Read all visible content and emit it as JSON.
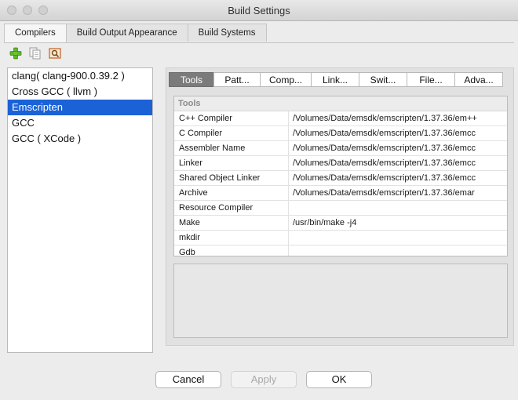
{
  "window": {
    "title": "Build Settings"
  },
  "top_tabs": [
    "Compilers",
    "Build Output Appearance",
    "Build Systems"
  ],
  "toolbar": {
    "add_icon": "plus-icon",
    "copy_icon": "copy-icon",
    "find_icon": "find-icon"
  },
  "compilers": [
    "clang( clang-900.0.39.2 )",
    "Cross GCC ( llvm )",
    "Emscripten",
    "GCC",
    "GCC ( XCode )"
  ],
  "selected_compiler": "Emscripten",
  "sub_tabs": [
    "Tools",
    "Patt...",
    "Comp...",
    "Link...",
    "Swit...",
    "File...",
    "Adva..."
  ],
  "tools_table": {
    "header": "Tools",
    "rows": [
      {
        "name": "C++ Compiler",
        "value": "/Volumes/Data/emsdk/emscripten/1.37.36/em++"
      },
      {
        "name": "C Compiler",
        "value": "/Volumes/Data/emsdk/emscripten/1.37.36/emcc"
      },
      {
        "name": "Assembler Name",
        "value": "/Volumes/Data/emsdk/emscripten/1.37.36/emcc"
      },
      {
        "name": "Linker",
        "value": "/Volumes/Data/emsdk/emscripten/1.37.36/emcc"
      },
      {
        "name": "Shared Object Linker",
        "value": "/Volumes/Data/emsdk/emscripten/1.37.36/emcc"
      },
      {
        "name": "Archive",
        "value": "/Volumes/Data/emsdk/emscripten/1.37.36/emar"
      },
      {
        "name": "Resource Compiler",
        "value": ""
      },
      {
        "name": "Make",
        "value": "/usr/bin/make -j4"
      },
      {
        "name": "mkdir",
        "value": ""
      },
      {
        "name": "Gdb",
        "value": ""
      }
    ]
  },
  "buttons": {
    "cancel": "Cancel",
    "apply": "Apply",
    "ok": "OK"
  }
}
